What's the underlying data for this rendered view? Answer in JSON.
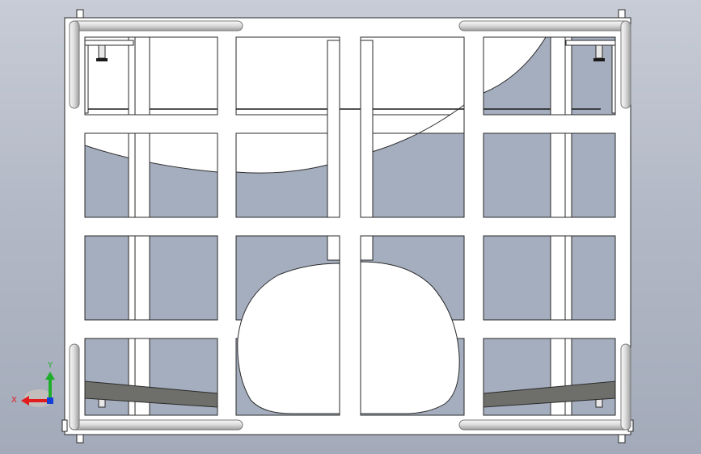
{
  "viewport": {
    "background_top": "#c7ccd6",
    "background_bottom": "#a3aab9",
    "model_fill": "#ffffff",
    "opening_fill": "#a5aebe",
    "edge_color": "#2a2a2a",
    "rail_fill": "#e6e6e6",
    "strap_fill": "#6e6e6a"
  },
  "triad": {
    "x_label": "X",
    "y_label": "Y",
    "x_color": "#e11c1c",
    "y_color": "#1fae2b",
    "z_color": "#1540d8"
  }
}
